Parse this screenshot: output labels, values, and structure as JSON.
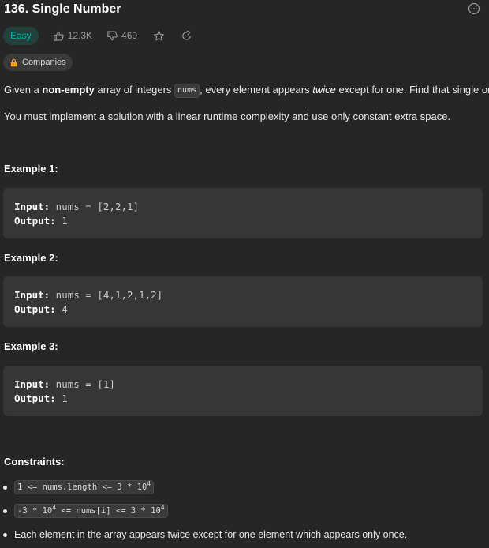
{
  "problem": {
    "title": "136. Single Number",
    "difficulty": "Easy",
    "likes": "12.3K",
    "dislikes": "469",
    "companies_label": "Companies"
  },
  "description": {
    "p1_a": "Given a ",
    "p1_bold": "non-empty",
    "p1_b": " array of integers ",
    "p1_code": "nums",
    "p1_c": ", every element appears ",
    "p1_italic": "twice",
    "p1_d": " except for one. Find that single one.",
    "p2": "You must implement a solution with a linear runtime complexity and use only constant extra space."
  },
  "examples": [
    {
      "title": "Example 1:",
      "input_label": "Input:",
      "input": " nums = [2,2,1]",
      "output_label": "Output:",
      "output": " 1"
    },
    {
      "title": "Example 2:",
      "input_label": "Input:",
      "input": " nums = [4,1,2,1,2]",
      "output_label": "Output:",
      "output": " 4"
    },
    {
      "title": "Example 3:",
      "input_label": "Input:",
      "input": " nums = [1]",
      "output_label": "Output:",
      "output": " 1"
    }
  ],
  "constraints": {
    "title": "Constraints:",
    "c1_text": "1 <= nums.length <= 3 * 10",
    "c1_exp": "4",
    "c2_a": "-3 * 10",
    "c2_exp1": "4",
    "c2_b": " <= nums[i] <= 3 * 10",
    "c2_exp2": "4",
    "c3": "Each element in the array appears twice except for one element which appears only once."
  },
  "colors": {
    "background": "#262626",
    "easy": "#00b8a3",
    "companies_lock": "#ffa116"
  }
}
